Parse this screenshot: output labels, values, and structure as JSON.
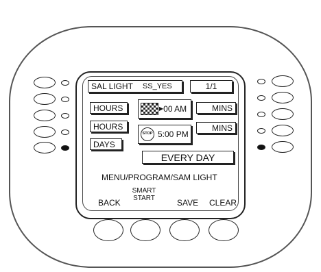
{
  "screen": {
    "title": "SAL LIGHT",
    "value": "SS_YES",
    "page": "1/1",
    "fields": {
      "hours1": "HOURS",
      "start_time": "00 AM",
      "mins1": "MINS",
      "hours2": "HOURS",
      "stop_time": "5:00 PM",
      "mins2": "MINS",
      "days": "DAYS",
      "every": "EVERY DAY"
    },
    "stop_icon_text": "STOP",
    "path": "MENU/PROGRAM/SAM LIGHT",
    "softkeys": {
      "back": "BACK",
      "smart_start": "SMART START",
      "save": "SAVE",
      "clear": "CLEAR"
    }
  },
  "indicators": {
    "left": [
      "off",
      "off",
      "off",
      "off",
      "on"
    ],
    "right": [
      "off",
      "off",
      "off",
      "off",
      "on"
    ]
  }
}
